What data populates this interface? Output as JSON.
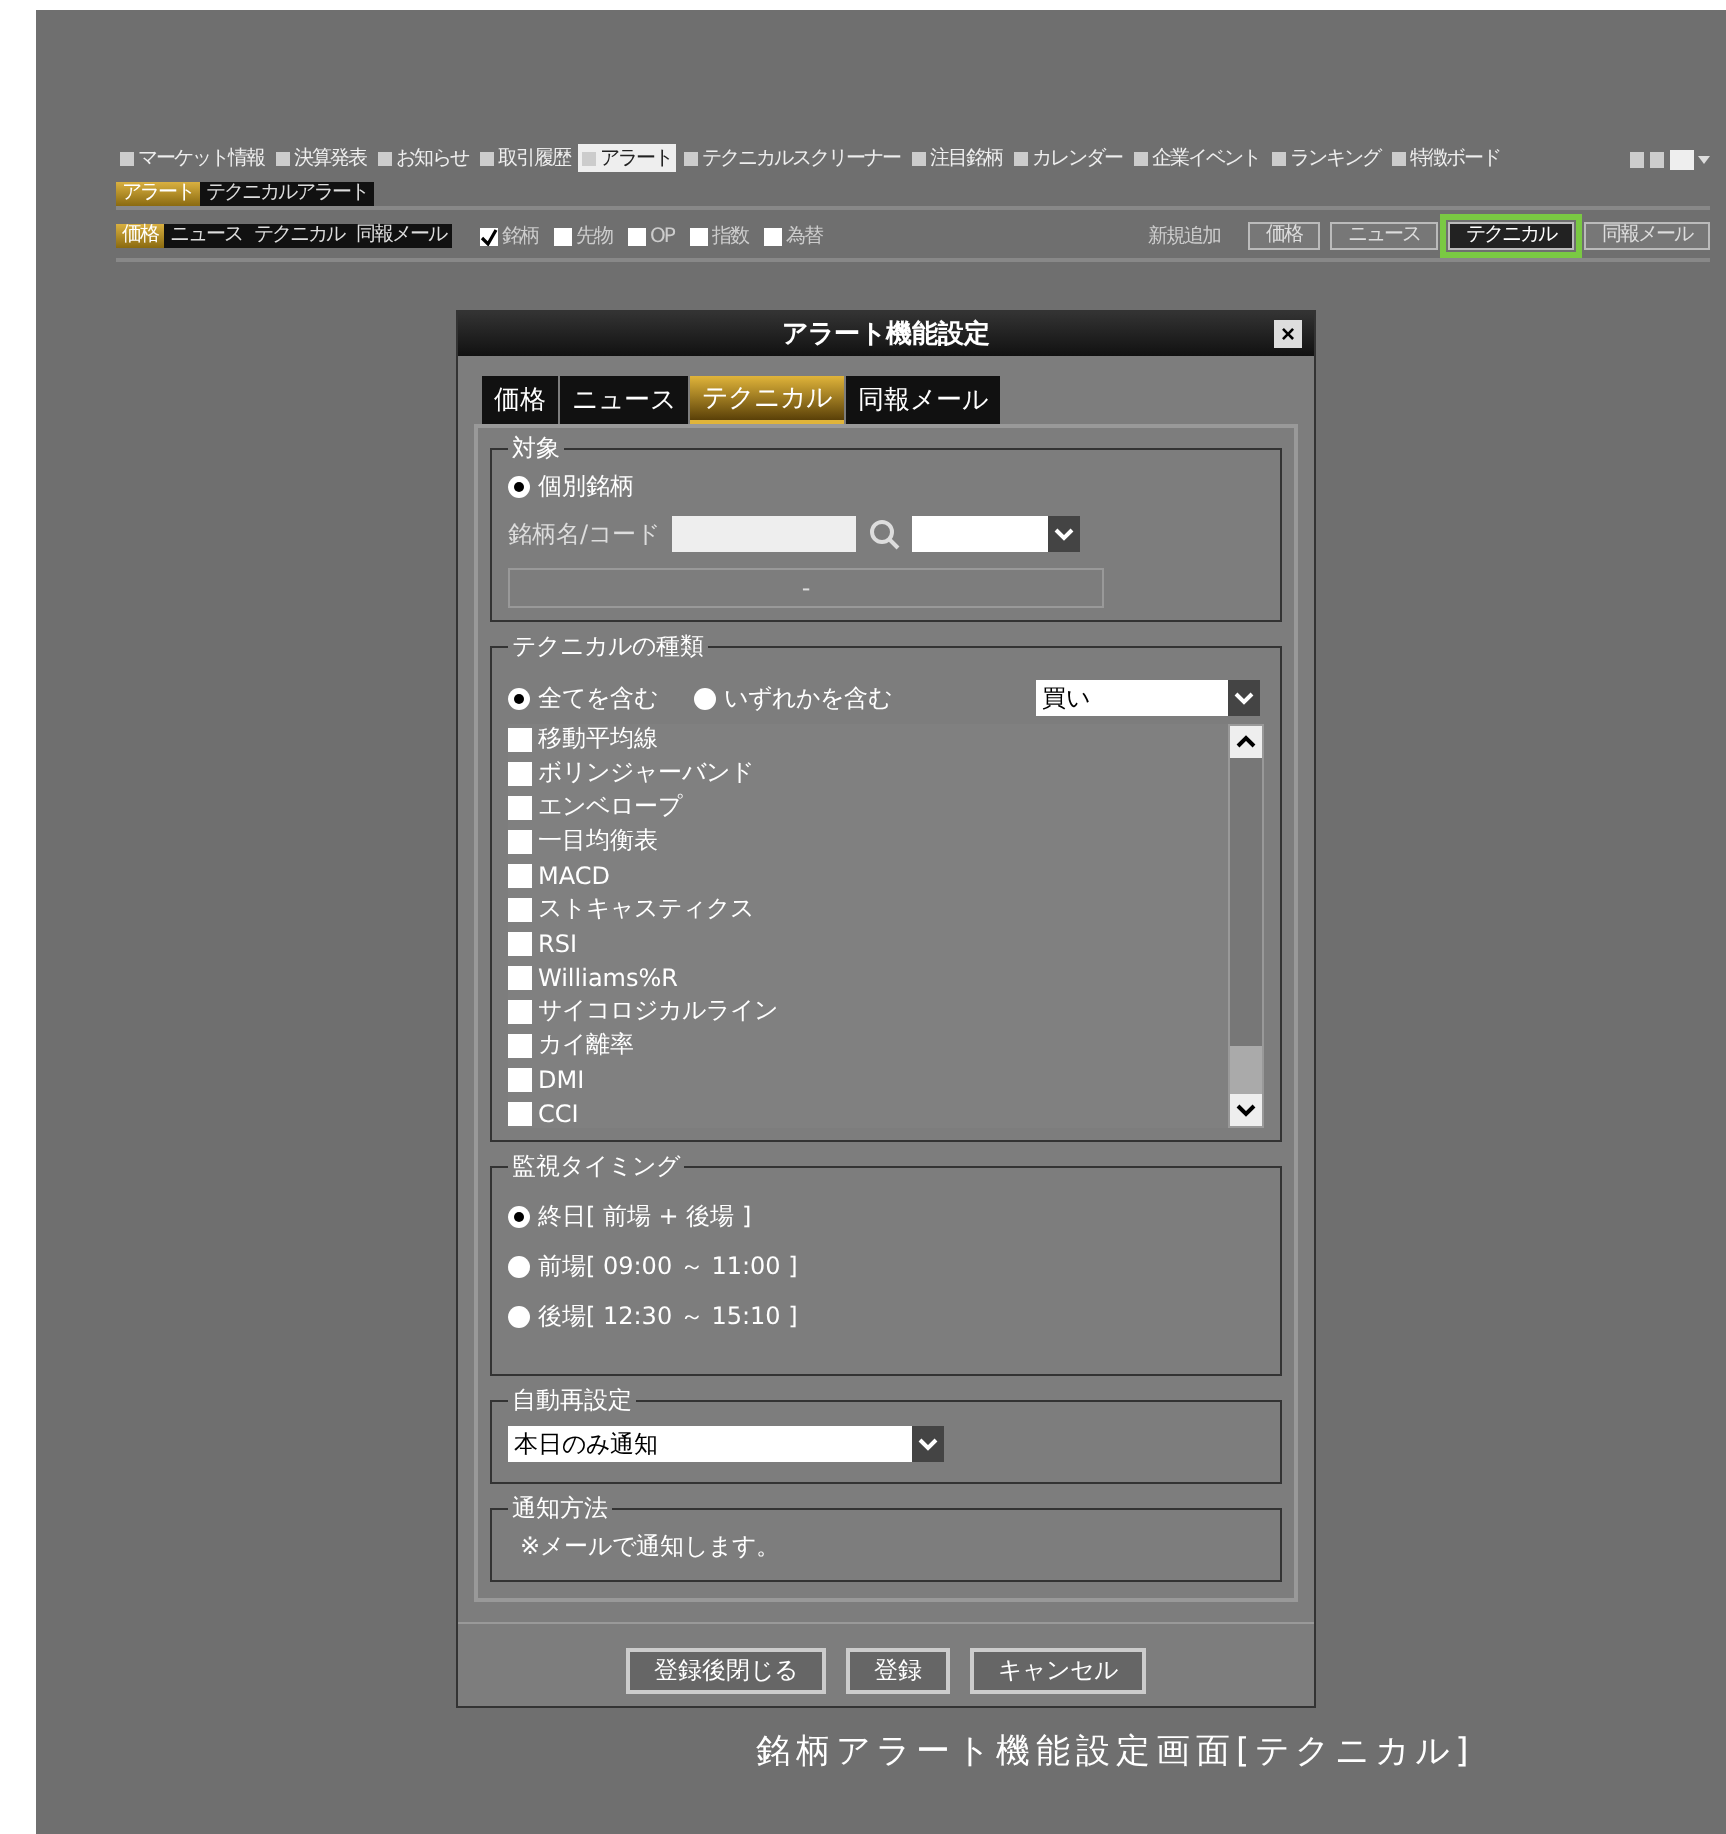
{
  "menu_tabs": [
    {
      "label": "マーケット情報",
      "selected": false
    },
    {
      "label": "決算発表",
      "selected": false
    },
    {
      "label": "お知らせ",
      "selected": false
    },
    {
      "label": "取引履歴",
      "selected": false
    },
    {
      "label": "アラート",
      "selected": true
    },
    {
      "label": "テクニカルスクリーナー",
      "selected": false
    },
    {
      "label": "注目銘柄",
      "selected": false
    },
    {
      "label": "カレンダー",
      "selected": false
    },
    {
      "label": "企業イベント",
      "selected": false
    },
    {
      "label": "ランキング",
      "selected": false
    },
    {
      "label": "特徴ボード",
      "selected": false
    }
  ],
  "sub_tabs": [
    {
      "label": "アラート",
      "selected": true
    },
    {
      "label": "テクニカルアラート",
      "selected": false
    }
  ],
  "filter_tabs": [
    {
      "label": "価格",
      "selected": true
    },
    {
      "label": "ニュース",
      "selected": false
    },
    {
      "label": "テクニカル",
      "selected": false
    },
    {
      "label": "同報メール",
      "selected": false
    }
  ],
  "filters": [
    {
      "label": "銘柄",
      "checked": true
    },
    {
      "label": "先物",
      "checked": false
    },
    {
      "label": "OP",
      "checked": false
    },
    {
      "label": "指数",
      "checked": false
    },
    {
      "label": "為替",
      "checked": false
    }
  ],
  "new_label": "新規追加",
  "new_buttons": [
    {
      "label": "価格",
      "selected": false
    },
    {
      "label": "ニュース",
      "selected": false
    },
    {
      "label": "テクニカル",
      "selected": true
    },
    {
      "label": "同報メール",
      "selected": false
    }
  ],
  "dialog": {
    "title": "アラート機能設定",
    "close": "×",
    "tabs": [
      {
        "label": "価格",
        "selected": false
      },
      {
        "label": "ニュース",
        "selected": false
      },
      {
        "label": "テクニカル",
        "selected": true
      },
      {
        "label": "同報メール",
        "selected": false
      }
    ],
    "target": {
      "legend": "対象",
      "radio": {
        "label": "個別銘柄",
        "selected": true
      },
      "code_label": "銘柄名/コード",
      "name_display": "-"
    },
    "types": {
      "legend": "テクニカルの種類",
      "modes": [
        {
          "label": "全てを含む",
          "selected": true
        },
        {
          "label": "いずれかを含む",
          "selected": false
        }
      ],
      "direction": "買い",
      "items": [
        {
          "label": "移動平均線",
          "checked": false
        },
        {
          "label": "ボリンジャーバンド",
          "checked": false
        },
        {
          "label": "エンベロープ",
          "checked": false
        },
        {
          "label": "一目均衡表",
          "checked": false
        },
        {
          "label": "MACD",
          "checked": false
        },
        {
          "label": "ストキャスティクス",
          "checked": false
        },
        {
          "label": "RSI",
          "checked": false
        },
        {
          "label": "Williams%R",
          "checked": false
        },
        {
          "label": "サイコロジカルライン",
          "checked": false
        },
        {
          "label": "カイ離率",
          "checked": false
        },
        {
          "label": "DMI",
          "checked": false
        },
        {
          "label": "CCI",
          "checked": false
        }
      ]
    },
    "timing": {
      "legend": "監視タイミング",
      "options": [
        {
          "label": "終日[ 前場 + 後場 ]",
          "selected": true
        },
        {
          "label": "前場[ 09:00 ～ 11:00 ]",
          "selected": false
        },
        {
          "label": "後場[ 12:30 ～ 15:10 ]",
          "selected": false
        }
      ]
    },
    "reset": {
      "legend": "自動再設定",
      "value": "本日のみ通知"
    },
    "notify": {
      "legend": "通知方法",
      "text": "※メールで通知します。"
    },
    "buttons": [
      "登録後閉じる",
      "登録",
      "キャンセル"
    ]
  },
  "caption": "銘柄アラート機能設定画面[テクニカル]"
}
